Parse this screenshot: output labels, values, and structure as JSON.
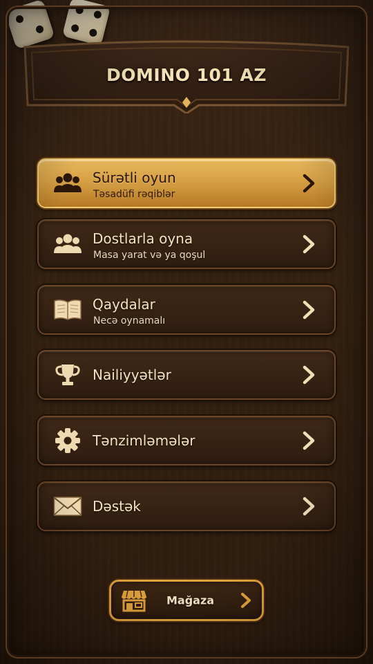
{
  "app": {
    "title": "DOMINO 101 AZ"
  },
  "menu": {
    "items": [
      {
        "label": "Sürətli oyun",
        "sub": "Təsadüfi rəqiblər",
        "icon": "users-group-icon",
        "active": true
      },
      {
        "label": "Dostlarla oyna",
        "sub": "Masa yarat və ya qoşul",
        "icon": "friends-icon",
        "active": false
      },
      {
        "label": "Qaydalar",
        "sub": "Necə oynamalı",
        "icon": "book-icon",
        "active": false
      },
      {
        "label": "Nailiyyətlər",
        "sub": "",
        "icon": "trophy-icon",
        "active": false
      },
      {
        "label": "Tənzimləmələr",
        "sub": "",
        "icon": "gear-icon",
        "active": false
      },
      {
        "label": "Dəstək",
        "sub": "",
        "icon": "envelope-icon",
        "active": false
      }
    ]
  },
  "shop": {
    "label": "Mağaza",
    "icon": "store-icon"
  },
  "colors": {
    "background": "#33200f",
    "gold": "#d7a046",
    "text_light": "#f4e3c3",
    "text_dark": "#2a1707"
  }
}
